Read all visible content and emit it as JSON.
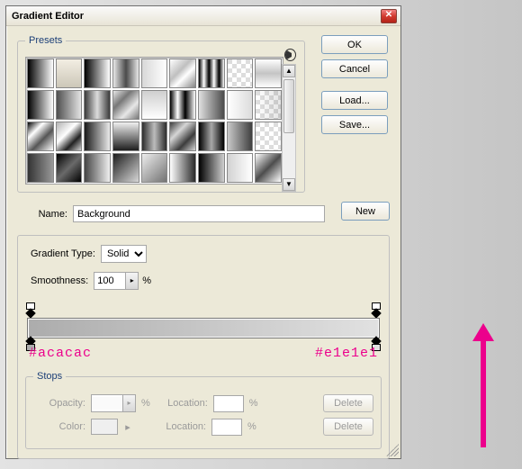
{
  "title": "Gradient Editor",
  "buttons": {
    "ok": "OK",
    "cancel": "Cancel",
    "load": "Load...",
    "save": "Save...",
    "new": "New"
  },
  "presets": {
    "legend": "Presets",
    "swatches": [
      "linear-gradient(to right,#000,#fff)",
      "linear-gradient(to bottom,#f3eee3,#ccc7b8)",
      "linear-gradient(to right,#000,transparent)",
      "linear-gradient(to right,#e8e8e8,#4a4a4a 50%,#e8e8e8)",
      "linear-gradient(to right,#d8d8d8,#fff)",
      "linear-gradient(135deg,#fff 0,#bfbfbf 40%,#fff 60%,#858585 100%)",
      "linear-gradient(to right,#000,#fff 20%,#000 40%,#fff 60%,#000 80%,#fff)",
      "repeating-conic-gradient(#fff 0 25%,#ddd 0 50%) 0 0/10px 10px",
      "linear-gradient(to bottom,#fff,#c4c4c4,#fff)",
      "linear-gradient(to right,#000,#fff)",
      "linear-gradient(to right,#4f4f4f,#e4e4e4)",
      "linear-gradient(to right,#3a3a3a,#dcdcdc 50%,#3a3a3a)",
      "linear-gradient(135deg,#e7e7e7,#777,#e7e7e7,#777)",
      "linear-gradient(to bottom,#cfcfcf,#fff)",
      "linear-gradient(to right,#000,#fff 30%,#000 60%,#fff)",
      "linear-gradient(to right,#e0e0e0,#4c4c4c)",
      "linear-gradient(to right,#fff,#dcdcdc)",
      "linear-gradient(to right,rgba(255,255,255,.1),rgba(0,0,0,.1)),repeating-conic-gradient(#fff 0 25%,#ddd 0 50%) 0 0/10px 10px",
      "linear-gradient(135deg,#000,#fff 30%,#555 60%,#fff)",
      "linear-gradient(135deg,#b3b3b3,#fff 40%,#222 70%,#d0d0d0)",
      "linear-gradient(to right,#1a1a1a,#eaeaea)",
      "linear-gradient(to bottom,#f0f0f0,#1e1e1e)",
      "linear-gradient(to right,#2d2d2d,#bcbcbc 50%,#2d2d2d)",
      "linear-gradient(135deg,#3c3c3c,#d6d6d6,#3c3c3c,#d6d6d6)",
      "linear-gradient(to right,#000,#a8a8a8,#000)",
      "linear-gradient(to right,#c9c9c9,#3f3f3f)",
      "repeating-conic-gradient(#fff 0 25%,#ddd 0 50%) 0 0/10px 10px",
      "linear-gradient(to right,#333,#999)",
      "linear-gradient(135deg,#000,#6a6a6a,#000)",
      "linear-gradient(to right,#444,#efefef)",
      "linear-gradient(135deg,#1c1c1c,#d7d7d7)",
      "linear-gradient(135deg,#ededed,#737373)",
      "linear-gradient(to right,#fff,#2a2a2a)",
      "linear-gradient(to right,#000,#cfcfcf)",
      "linear-gradient(to right,#d2d2d2,#fff)",
      "linear-gradient(135deg,#fff,#4d4d4d,#fff)"
    ]
  },
  "name": {
    "label": "Name:",
    "value": "Background"
  },
  "gradient_type": {
    "label": "Gradient Type:",
    "value": "Solid"
  },
  "smoothness": {
    "label": "Smoothness:",
    "value": "100",
    "unit": "%"
  },
  "gradient": {
    "left_hex": "#acacac",
    "right_hex": "#e1e1e1"
  },
  "stops": {
    "legend": "Stops",
    "opacity_label": "Opacity:",
    "color_label": "Color:",
    "location_label": "Location:",
    "unit": "%",
    "delete": "Delete"
  }
}
